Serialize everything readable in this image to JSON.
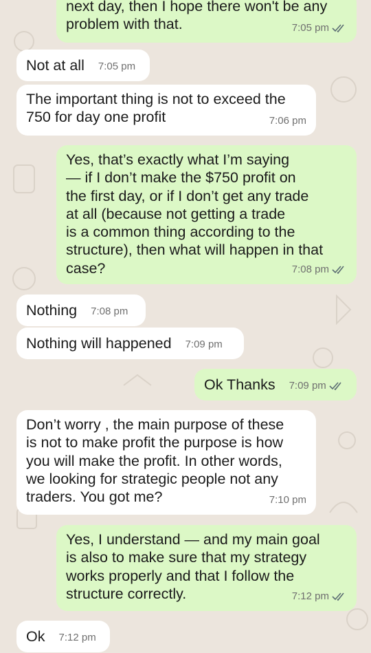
{
  "conversation": {
    "messages": [
      {
        "id": "m1",
        "direction": "outgoing",
        "text": "next day, then I hope there won't be any\nproblem with that.",
        "time": "7:05 pm",
        "status": "read"
      },
      {
        "id": "m2",
        "direction": "incoming",
        "text": "Not at all",
        "time": "7:05 pm"
      },
      {
        "id": "m3",
        "direction": "incoming",
        "text": "The important thing is not to exceed the\n750 for day one profit",
        "time": "7:06 pm"
      },
      {
        "id": "m4",
        "direction": "outgoing",
        "text": "Yes, that’s exactly what I’m saying\n— if I don’t make the $750 profit on\nthe first day, or if I don’t get any trade\nat all (because not getting a trade\nis a common thing according to the\nstructure), then what will happen in that\ncase?",
        "time": "7:08 pm",
        "status": "read"
      },
      {
        "id": "m5",
        "direction": "incoming",
        "text": "Nothing",
        "time": "7:08 pm"
      },
      {
        "id": "m6",
        "direction": "incoming",
        "text": "Nothing will happened",
        "time": "7:09 pm"
      },
      {
        "id": "m7",
        "direction": "outgoing",
        "text": "Ok Thanks",
        "time": "7:09 pm",
        "status": "read"
      },
      {
        "id": "m8",
        "direction": "incoming",
        "text": "Don’t worry , the main purpose of these\nis not to make profit the purpose is how\nyou will make the profit. In other words,\nwe looking for strategic people not any\ntraders. You got me?",
        "time": "7:10 pm"
      },
      {
        "id": "m9",
        "direction": "outgoing",
        "text": "Yes, I understand — and my main goal\nis also to make sure that my strategy\nworks properly and that I follow the\nstructure correctly.",
        "time": "7:12 pm",
        "status": "read"
      },
      {
        "id": "m10",
        "direction": "incoming",
        "text": "Ok",
        "time": "7:12 pm"
      }
    ]
  },
  "colors": {
    "background": "#ece5dd",
    "incoming_bubble": "#ffffff",
    "outgoing_bubble": "#dcf8c6",
    "timestamp": "#6f6f6f",
    "read_tick": "#5a6b72"
  },
  "icons": {
    "read_receipt": "double-check-icon"
  }
}
